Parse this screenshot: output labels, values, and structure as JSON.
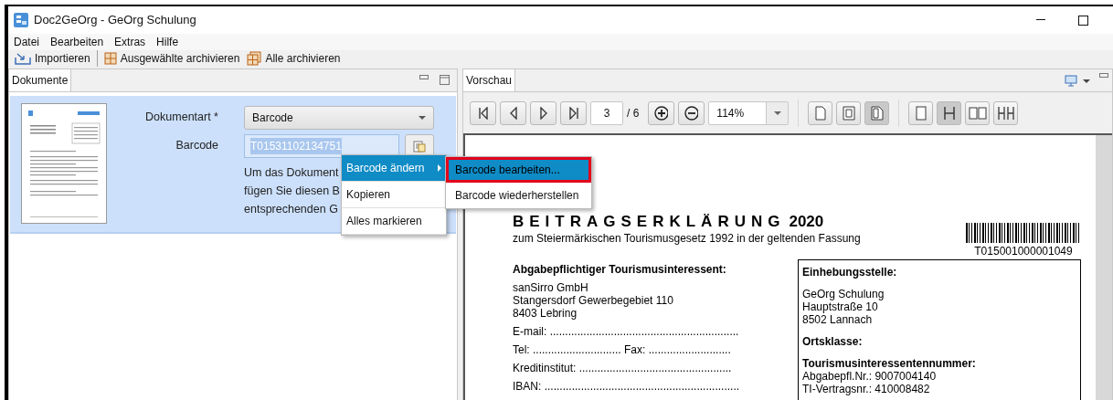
{
  "window": {
    "title": "Doc2GeOrg - GeOrg Schulung"
  },
  "menu": [
    "Datei",
    "Bearbeiten",
    "Extras",
    "Hilfe"
  ],
  "toolbar": [
    {
      "kind": "import",
      "label": "Importieren"
    },
    {
      "kind": "archive",
      "label": "Ausgewählte archivieren"
    },
    {
      "kind": "archive_all",
      "label": "Alle archivieren"
    }
  ],
  "documents_panel": {
    "tab": {
      "label": "Dokumente",
      "selected": true
    },
    "document": {
      "selected": true,
      "fields": [
        {
          "kind": "select",
          "label": "Dokumentart *",
          "value": "Barcode"
        },
        {
          "kind": "text",
          "label": "Barcode",
          "value": "T01531102134751",
          "text_selected": true
        }
      ],
      "hint_lines": [
        "Um das Dokument",
        "fügen Sie diesen B",
        "entsprechenden G"
      ]
    }
  },
  "context_menu": {
    "items": [
      {
        "label": "Barcode ändern",
        "has_submenu": true,
        "selected": true
      },
      {
        "label": "Kopieren",
        "has_submenu": false,
        "selected": false
      },
      {
        "label": "Alles markieren",
        "has_submenu": false,
        "selected": false
      }
    ],
    "submenu": [
      {
        "label": "Barcode bearbeiten...",
        "selected": true,
        "highlighted": true
      },
      {
        "label": "Barcode wiederherstellen",
        "selected": false,
        "highlighted": false
      }
    ]
  },
  "preview_panel": {
    "tab": {
      "label": "Vorschau",
      "selected": true
    },
    "nav_buttons": [
      {
        "kind": "first"
      },
      {
        "kind": "prev"
      },
      {
        "kind": "next"
      },
      {
        "kind": "last"
      }
    ],
    "page": "3",
    "page_total": "/ 6",
    "zoom": "114%",
    "page_fit_buttons": [
      {
        "kind": "page",
        "pressed": false
      },
      {
        "kind": "page_width",
        "pressed": false
      },
      {
        "kind": "page_fold",
        "pressed": true
      }
    ],
    "layout_buttons": [
      {
        "kind": "single",
        "pressed": false
      },
      {
        "kind": "continuous",
        "pressed": true
      },
      {
        "kind": "facing",
        "pressed": false
      },
      {
        "kind": "facing_continuous",
        "pressed": false
      }
    ],
    "document": {
      "title": "BEITRAGSERKLÄRUNG",
      "year": "2020",
      "subtitle": "zum Steiermärkischen Tourismusgesetz 1992 in der geltenden Fassung",
      "barcode_number": "T015001000001049",
      "left_heading": "Abgabepflichtiger Tourismusinteressent:",
      "address": [
        "sanSirro GmbH",
        "Stangersdorf Gewerbegebiet 110",
        "8403 Lebring"
      ],
      "form_lines": [
        "E-mail: ..............................................................",
        "Tel: ............................. Fax: ...........................",
        "Kreditinstitut: ..................................................",
        "IBAN: ................................................................"
      ],
      "right_heading": "Einhebungsstelle:",
      "office": [
        "GeOrg Schulung",
        "Hauptstraße 10",
        "8502 Lannach"
      ],
      "class_heading": "Ortsklasse:",
      "number_heading": "Tourismusinteressentennummer:",
      "numbers": [
        "Abgabepfl.Nr.: 9007004140",
        "TI-Vertragsnr.: 410008482"
      ]
    }
  }
}
